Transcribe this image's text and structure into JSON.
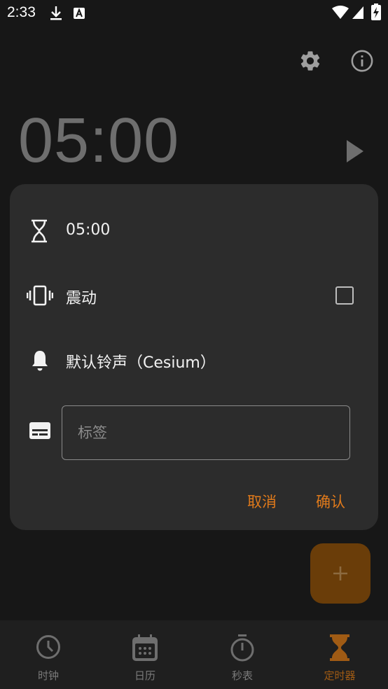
{
  "status_bar": {
    "time": "2:33"
  },
  "timer": {
    "display": "05:00"
  },
  "dialog": {
    "duration": "05:00",
    "vibrate_label": "震动",
    "vibrate_checked": false,
    "ringtone_label": "默认铃声（Cesium）",
    "label_placeholder": "标签",
    "label_value": "",
    "cancel_label": "取消",
    "confirm_label": "确认"
  },
  "fab": {
    "icon": "plus-icon"
  },
  "bottom_nav": {
    "items": [
      {
        "label": "时钟",
        "icon": "clock-icon",
        "active": false
      },
      {
        "label": "日历",
        "icon": "calendar-icon",
        "active": false
      },
      {
        "label": "秒表",
        "icon": "stopwatch-icon",
        "active": false
      },
      {
        "label": "定时器",
        "icon": "hourglass-icon",
        "active": true
      }
    ]
  },
  "colors": {
    "accent": "#e07a1b",
    "background": "#171717",
    "dialog": "#2c2c2c",
    "fab": "#6a3d09"
  }
}
